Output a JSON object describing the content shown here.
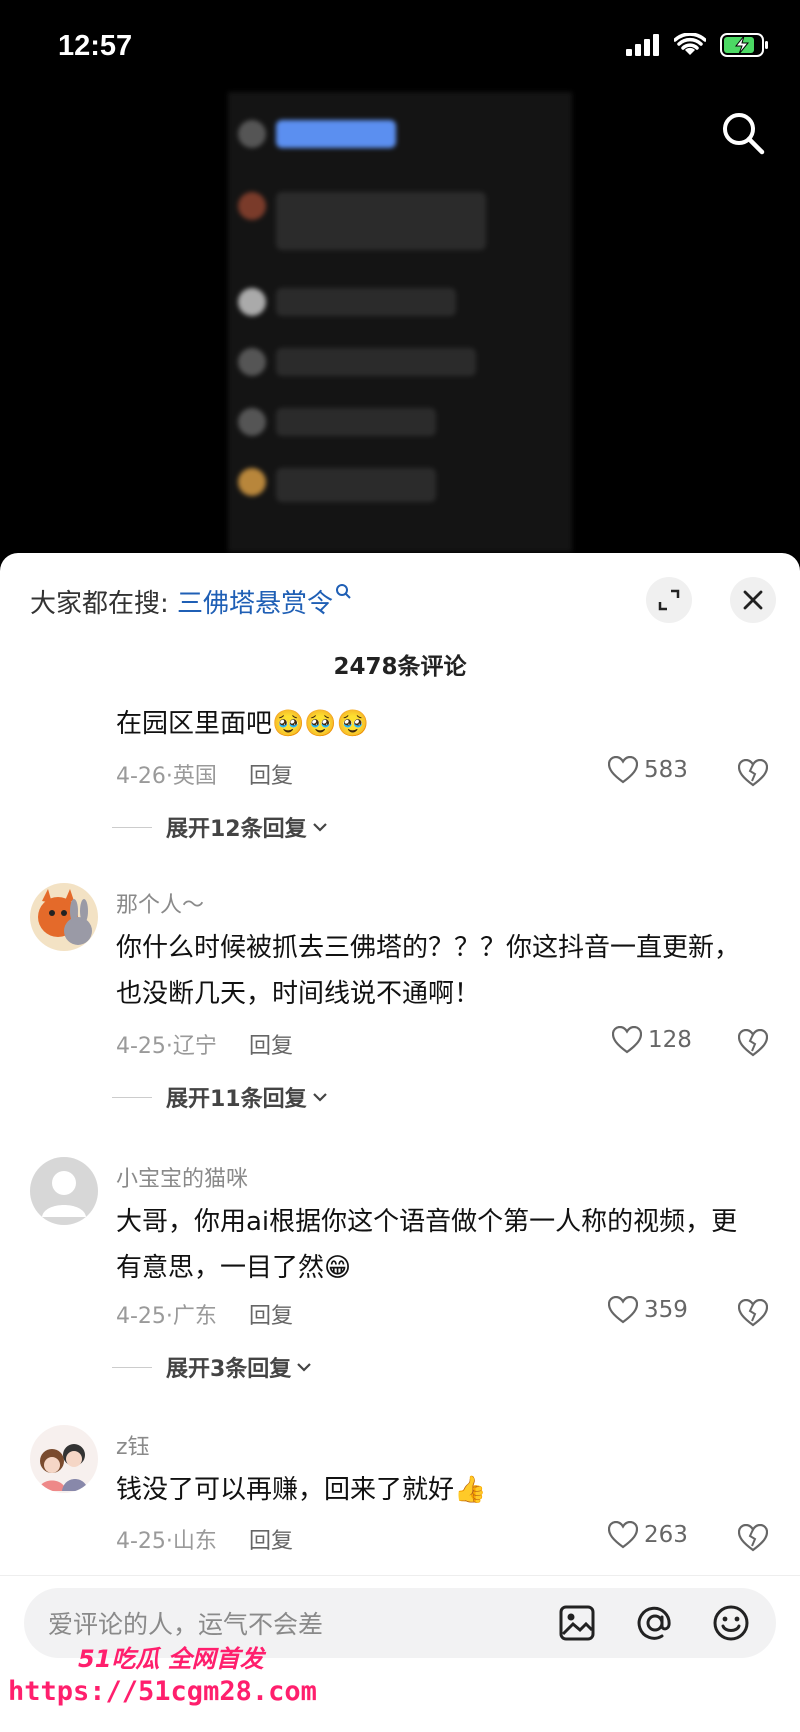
{
  "status_bar": {
    "time": "12:57"
  },
  "sheet": {
    "suggest_prefix": "大家都在搜:",
    "suggest_keyword": "三佛塔悬赏令",
    "comment_count": "2478条评论"
  },
  "comments": [
    {
      "text": "在园区里面吧🥹🥹🥹",
      "meta": "4-26·英国",
      "reply": "回复",
      "likes": "583",
      "expand": "展开12条回复"
    },
    {
      "name": "那个人～",
      "text": "你什么时候被抓去三佛塔的？？？你这抖音一直更新，也没断几天，时间线说不通啊！",
      "meta": "4-25·辽宁",
      "reply": "回复",
      "likes": "128",
      "expand": "展开11条回复"
    },
    {
      "name": "小宝宝的猫咪",
      "text": "大哥，你用ai根据你这个语音做个第一人称的视频，更有意思，一目了然😁",
      "meta": "4-25·广东",
      "reply": "回复",
      "likes": "359",
      "expand": "展开3条回复"
    },
    {
      "name": "z钰",
      "text": "钱没了可以再赚，回来了就好👍",
      "meta": "4-25·山东",
      "reply": "回复",
      "likes": "263"
    }
  ],
  "input": {
    "placeholder": "爱评论的人，运气不会差"
  },
  "watermark": {
    "line1": "51吃瓜 全网首发",
    "line2": "https://51cgm28.com"
  },
  "colors": {
    "accent_link": "#1f5fb5",
    "watermark": "#ff1f6d"
  }
}
